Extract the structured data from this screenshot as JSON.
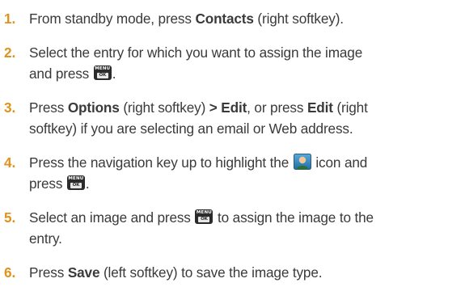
{
  "steps": [
    {
      "num": "1.",
      "a": "From standby mode, press ",
      "b": "Contacts",
      "c": " (right softkey)."
    },
    {
      "num": "2.",
      "line1": "Select the entry for which you want to assign the image",
      "line2a": "and press ",
      "line2b": "."
    },
    {
      "num": "3.",
      "a": "Press ",
      "b": "Options",
      "c": " (right softkey) ",
      "d": "> Edit",
      "e": ", or press ",
      "f": "Edit",
      "g": " (right",
      "line2": "softkey) if you are selecting an email or Web address."
    },
    {
      "num": "4.",
      "a": "Press the navigation key up to highlight the ",
      "b": " icon and",
      "line2a": "press ",
      "line2b": "."
    },
    {
      "num": "5.",
      "a": "Select an image and press ",
      "b": " to assign the image to the",
      "line2": "entry."
    },
    {
      "num": "6.",
      "a": "Press ",
      "b": "Save",
      "c": " (left softkey) to save the image type."
    }
  ],
  "menu_key": {
    "top": "MENU",
    "bottom": "OK",
    "icon": "menu-ok-key-icon"
  },
  "contact_icon": "contact-picture-icon",
  "colors": {
    "number": "#e0921c",
    "text": "#3a3a3a",
    "key_bg": "#2b2b2b"
  }
}
